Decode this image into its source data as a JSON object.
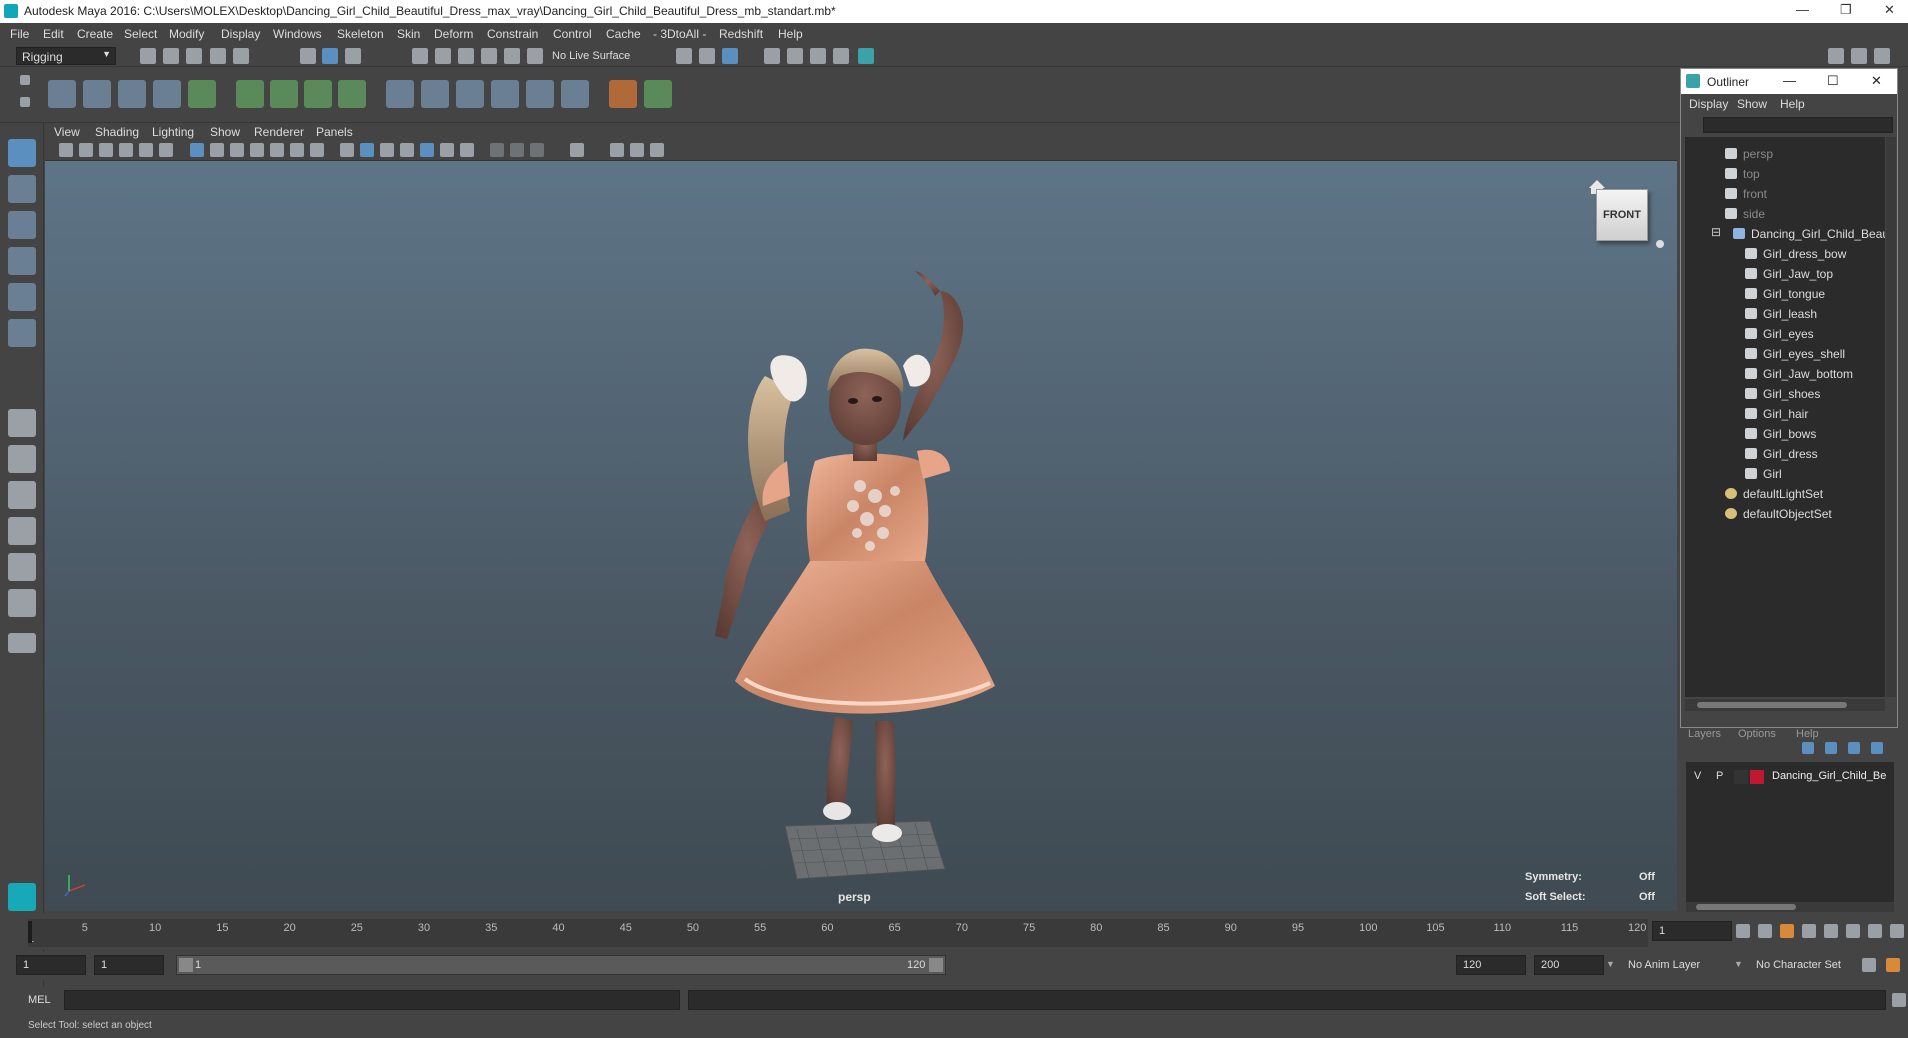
{
  "window": {
    "title": "Autodesk Maya 2016: C:\\Users\\MOLEX\\Desktop\\Dancing_Girl_Child_Beautiful_Dress_max_vray\\Dancing_Girl_Child_Beautiful_Dress_mb_standart.mb*",
    "controls": {
      "minimize": "—",
      "restore": "❐",
      "close": "✕"
    }
  },
  "menubar": [
    "File",
    "Edit",
    "Create",
    "Select",
    "Modify",
    "Display",
    "Windows",
    "Skeleton",
    "Skin",
    "Deform",
    "Constrain",
    "Control",
    "Cache",
    "- 3DtoAll -",
    "Redshift",
    "Help"
  ],
  "statusline": {
    "mode": "Rigging",
    "live_surface": "No Live Surface"
  },
  "panel_menu": [
    "View",
    "Shading",
    "Lighting",
    "Show",
    "Renderer",
    "Panels"
  ],
  "viewport": {
    "camera": "persp",
    "viewcube_label": "FRONT",
    "hud": {
      "symmetry_label": "Symmetry:",
      "symmetry_value": "Off",
      "soft_select_label": "Soft Select:",
      "soft_select_value": "Off"
    }
  },
  "outliner": {
    "title": "Outliner",
    "menu": [
      "Display",
      "Show",
      "Help"
    ],
    "items": [
      {
        "label": "persp",
        "type": "camera",
        "indent": 0,
        "dim": true
      },
      {
        "label": "top",
        "type": "camera",
        "indent": 0,
        "dim": true
      },
      {
        "label": "front",
        "type": "camera",
        "indent": 0,
        "dim": true
      },
      {
        "label": "side",
        "type": "camera",
        "indent": 0,
        "dim": true
      },
      {
        "label": "Dancing_Girl_Child_Beautif",
        "type": "group",
        "indent": 0,
        "dim": false
      },
      {
        "label": "Girl_dress_bow",
        "type": "mesh",
        "indent": 1,
        "dim": false
      },
      {
        "label": "Girl_Jaw_top",
        "type": "mesh",
        "indent": 1,
        "dim": false
      },
      {
        "label": "Girl_tongue",
        "type": "mesh",
        "indent": 1,
        "dim": false
      },
      {
        "label": "Girl_leash",
        "type": "mesh",
        "indent": 1,
        "dim": false
      },
      {
        "label": "Girl_eyes",
        "type": "mesh",
        "indent": 1,
        "dim": false
      },
      {
        "label": "Girl_eyes_shell",
        "type": "mesh",
        "indent": 1,
        "dim": false
      },
      {
        "label": "Girl_Jaw_bottom",
        "type": "mesh",
        "indent": 1,
        "dim": false
      },
      {
        "label": "Girl_shoes",
        "type": "mesh",
        "indent": 1,
        "dim": false
      },
      {
        "label": "Girl_hair",
        "type": "mesh",
        "indent": 1,
        "dim": false
      },
      {
        "label": "Girl_bows",
        "type": "mesh",
        "indent": 1,
        "dim": false
      },
      {
        "label": "Girl_dress",
        "type": "mesh",
        "indent": 1,
        "dim": false
      },
      {
        "label": "Girl",
        "type": "mesh",
        "indent": 1,
        "dim": false
      },
      {
        "label": "defaultLightSet",
        "type": "set",
        "indent": 0,
        "dim": false
      },
      {
        "label": "defaultObjectSet",
        "type": "set",
        "indent": 0,
        "dim": false
      }
    ]
  },
  "layers": {
    "menu": [
      "Layers",
      "Options",
      "Help"
    ],
    "row": {
      "v": "V",
      "p": "P",
      "name": "Dancing_Girl_Child_Be",
      "color": "#c0182e"
    }
  },
  "timeline": {
    "ticks": [
      "5",
      "10",
      "15",
      "20",
      "25",
      "30",
      "35",
      "40",
      "45",
      "50",
      "55",
      "60",
      "65",
      "70",
      "75",
      "80",
      "85",
      "90",
      "95",
      "100",
      "105",
      "110",
      "115",
      "120"
    ],
    "start_tick": "1",
    "current_frame": "1"
  },
  "range": {
    "start": "1",
    "anim_start": "1",
    "slider_start": "1",
    "slider_end": "120",
    "anim_end": "120",
    "end": "200",
    "anim_layer": "No Anim Layer",
    "character_set": "No Character Set"
  },
  "command": {
    "label": "MEL"
  },
  "help_line": "Select Tool: select an object"
}
